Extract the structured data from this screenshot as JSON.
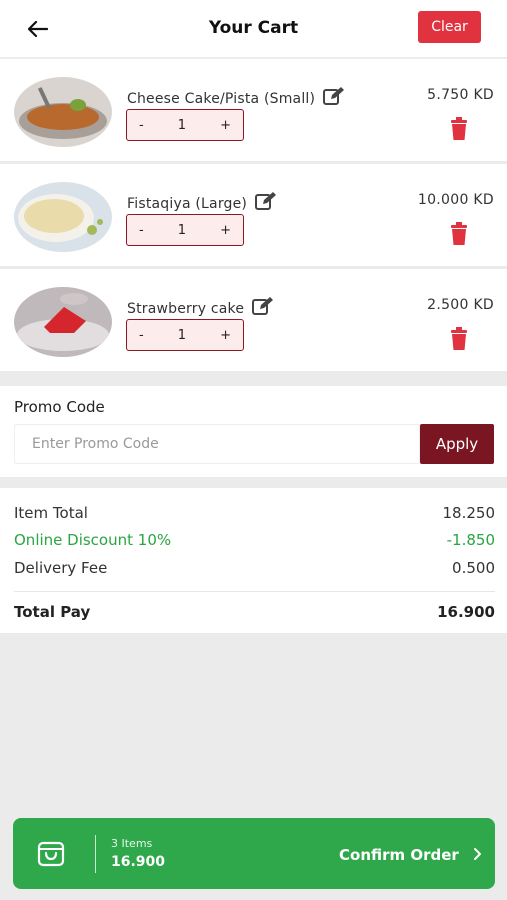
{
  "header": {
    "title": "Your Cart",
    "clear_label": "Clear"
  },
  "cart": {
    "items": [
      {
        "name": "Cheese Cake/Pista (Small)",
        "qty": "1",
        "price": "5.750 KD",
        "minus": "-",
        "plus": "+"
      },
      {
        "name": "Fistaqiya (Large)",
        "qty": "1",
        "price": "10.000 KD",
        "minus": "-",
        "plus": "+"
      },
      {
        "name": "Strawberry cake",
        "qty": "1",
        "price": "2.500 KD",
        "minus": "-",
        "plus": "+"
      }
    ]
  },
  "promo": {
    "label": "Promo Code",
    "placeholder": "Enter Promo Code",
    "apply_label": "Apply"
  },
  "summary": {
    "item_total_label": "Item Total",
    "item_total": "18.250",
    "discount_label": "Online Discount 10%",
    "discount": "-1.850",
    "delivery_label": "Delivery Fee",
    "delivery": "0.500",
    "total_label": "Total Pay",
    "total": "16.900"
  },
  "footer": {
    "count": "3 Items",
    "amount": "16.900",
    "confirm_label": "Confirm Order"
  },
  "colors": {
    "accent_red": "#e0323f",
    "apply_maroon": "#7a1622",
    "confirm_green": "#2ea84a",
    "discount_green": "#2ba542"
  }
}
